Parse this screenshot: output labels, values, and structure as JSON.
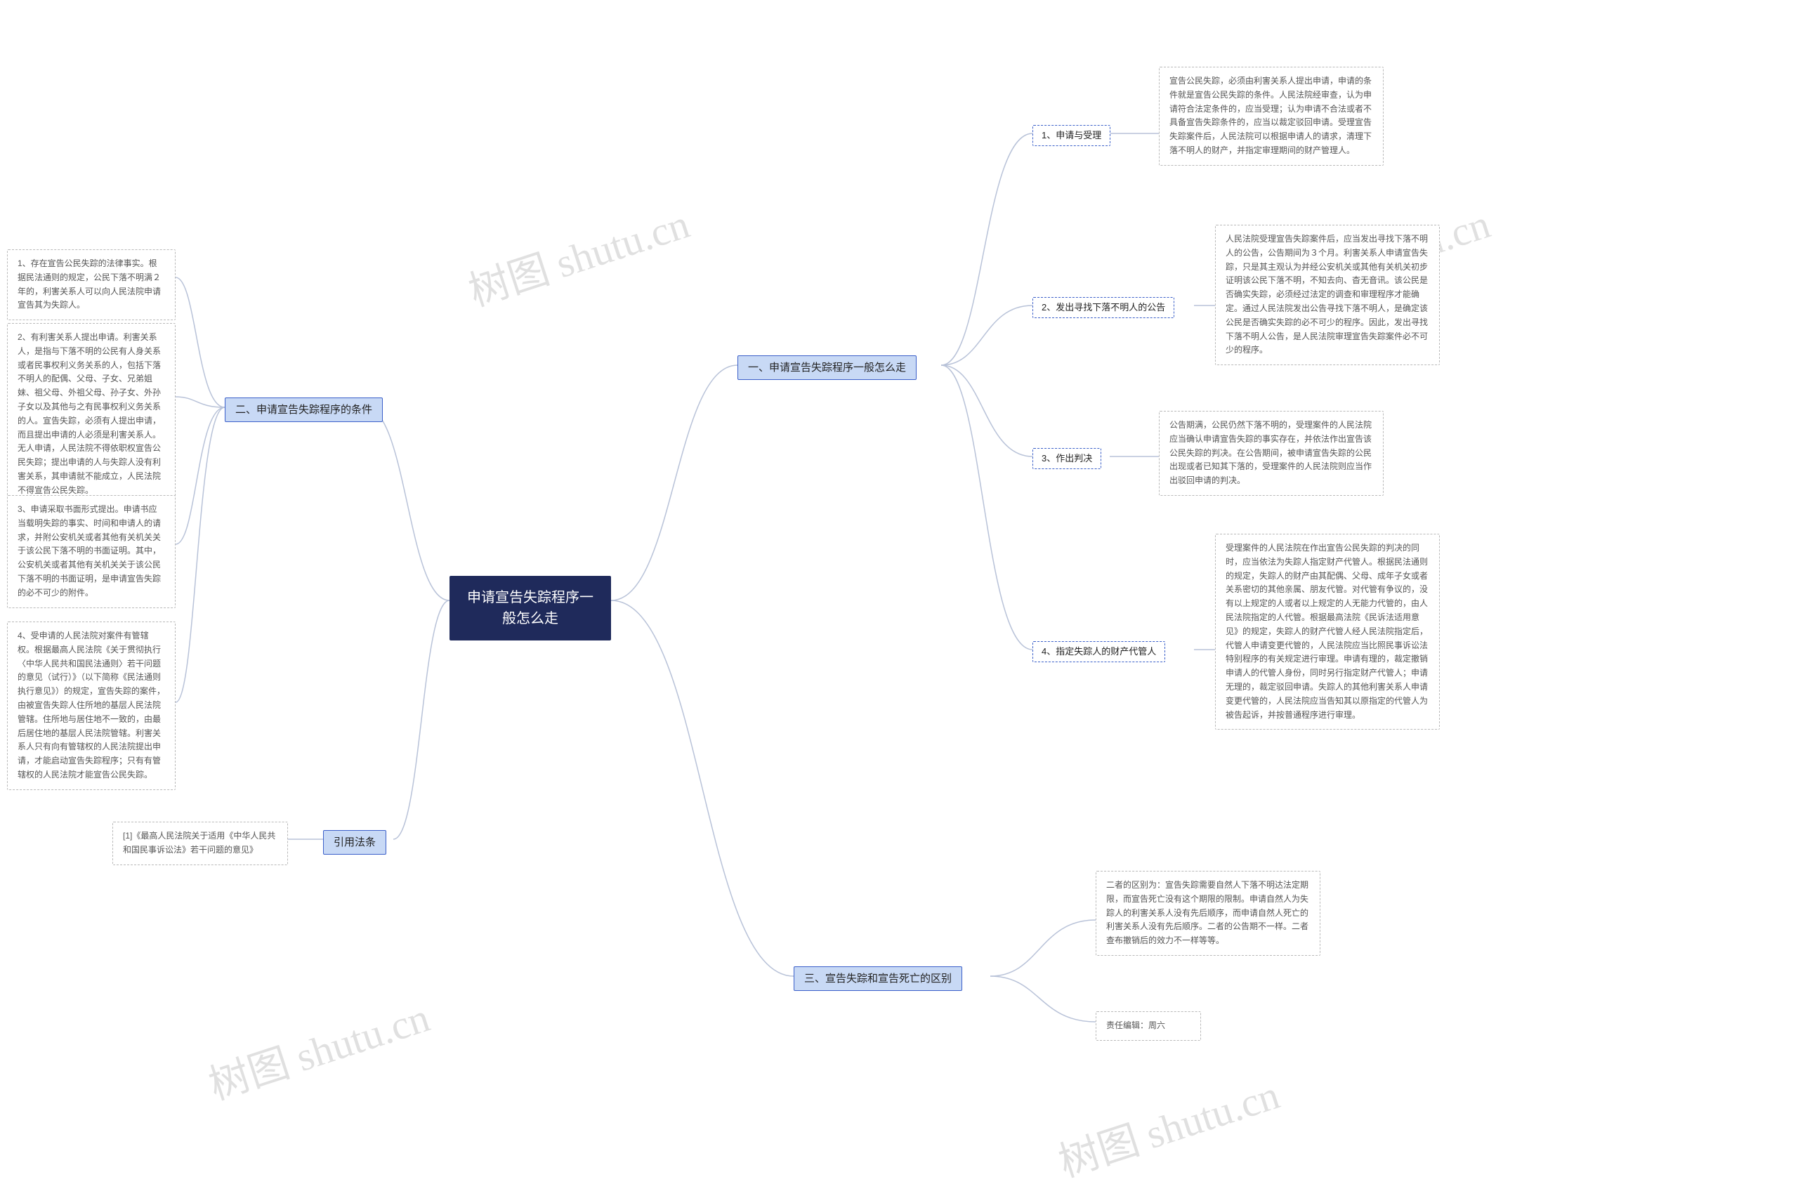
{
  "root": {
    "title": "申请宣告失踪程序一般怎么走"
  },
  "branches": {
    "b1": {
      "label": "一、申请宣告失踪程序一般怎么走"
    },
    "b2": {
      "label": "二、申请宣告失踪程序的条件"
    },
    "b3": {
      "label": "三、宣告失踪和宣告死亡的区别"
    },
    "b4": {
      "label": "引用法条"
    }
  },
  "subnodes": {
    "s1_1": {
      "label": "1、申请与受理"
    },
    "s1_2": {
      "label": "2、发出寻找下落不明人的公告"
    },
    "s1_3": {
      "label": "3、作出判决"
    },
    "s1_4": {
      "label": "4、指定失踪人的财产代管人"
    }
  },
  "leaves": {
    "l1_1": "宣告公民失踪，必须由利害关系人提出申请，申请的条件就是宣告公民失踪的条件。人民法院经审查，认为申请符合法定条件的，应当受理；认为申请不合法或者不具备宣告失踪条件的，应当以裁定驳回申请。受理宣告失踪案件后，人民法院可以根据申请人的请求，清理下落不明人的财产，并指定审理期间的财产管理人。",
    "l1_2": "人民法院受理宣告失踪案件后，应当发出寻找下落不明人的公告，公告期间为３个月。利害关系人申请宣告失踪，只是其主观认为并经公安机关或其他有关机关初步证明该公民下落不明，不知去向、杳无音讯。该公民是否确实失踪，必须经过法定的调查和审理程序才能确定。通过人民法院发出公告寻找下落不明人，是确定该公民是否确实失踪的必不可少的程序。因此，发出寻找下落不明人公告，是人民法院审理宣告失踪案件必不可少的程序。",
    "l1_3": "公告期满，公民仍然下落不明的，受理案件的人民法院应当确认申请宣告失踪的事实存在，并依法作出宣告该公民失踪的判决。在公告期间，被申请宣告失踪的公民出现或者已知其下落的，受理案件的人民法院则应当作出驳回申请的判决。",
    "l1_4": "受理案件的人民法院在作出宣告公民失踪的判决的同时，应当依法为失踪人指定财产代管人。根据民法通则的规定，失踪人的财产由其配偶、父母、成年子女或者关系密切的其他亲属、朋友代管。对代管有争议的，没有以上规定的人或者以上规定的人无能力代管的，由人民法院指定的人代管。根据最高法院《民诉法适用意见》的规定，失踪人的财产代管人经人民法院指定后，代管人申请变更代管的，人民法院应当比照民事诉讼法特别程序的有关规定进行审理。申请有理的，裁定撤销申请人的代管人身份，同时另行指定财产代管人；申请无理的，裁定驳回申请。失踪人的其他利害关系人申请变更代管的，人民法院应当告知其以原指定的代管人为被告起诉，并按普通程序进行审理。",
    "l2_1": "1、存在宣告公民失踪的法律事实。根据民法通则的规定，公民下落不明满２年的，利害关系人可以向人民法院申请宣告其为失踪人。",
    "l2_2": "2、有利害关系人提出申请。利害关系人，是指与下落不明的公民有人身关系或者民事权利义务关系的人，包括下落不明人的配偶、父母、子女、兄弟姐妹、祖父母、外祖父母、孙子女、外孙子女以及其他与之有民事权利义务关系的人。宣告失踪，必须有人提出申请，而且提出申请的人必须是利害关系人。无人申请，人民法院不得依职权宣告公民失踪；提出申请的人与失踪人没有利害关系，其申请就不能成立，人民法院不得宣告公民失踪。",
    "l2_3": "3、申请采取书面形式提出。申请书应当载明失踪的事实、时间和申请人的请求，并附公安机关或者其他有关机关关于该公民下落不明的书面证明。其中，公安机关或者其他有关机关关于该公民下落不明的书面证明，是申请宣告失踪的必不可少的附件。",
    "l2_4": "4、受申请的人民法院对案件有管辖权。根据最高人民法院《关于贯彻执行〈中华人民共和国民法通则〉若干问题的意见（试行）》（以下简称《民法通则执行意见》）的规定，宣告失踪的案件，由被宣告失踪人住所地的基层人民法院管辖。住所地与居住地不一致的，由最后居住地的基层人民法院管辖。利害关系人只有向有管辖权的人民法院提出申请，才能启动宣告失踪程序；只有有管辖权的人民法院才能宣告公民失踪。",
    "l3_1": "二者的区别为：宣告失踪需要自然人下落不明达法定期限，而宣告死亡没有这个期限的限制。申请自然人为失踪人的利害关系人没有先后顺序，而申请自然人死亡的利害关系人没有先后顺序。二者的公告期不一样。二者查布撤销后的效力不一样等等。",
    "l3_2": "责任编辑：周六",
    "l4_1": "[1]《最高人民法院关于适用《中华人民共和国民事诉讼法》若干问题的意见》"
  },
  "watermarks": [
    "树图 shutu.cn",
    "树图 shutu.cn",
    "树图 shutu.cn",
    "树图 shutu.cn"
  ]
}
